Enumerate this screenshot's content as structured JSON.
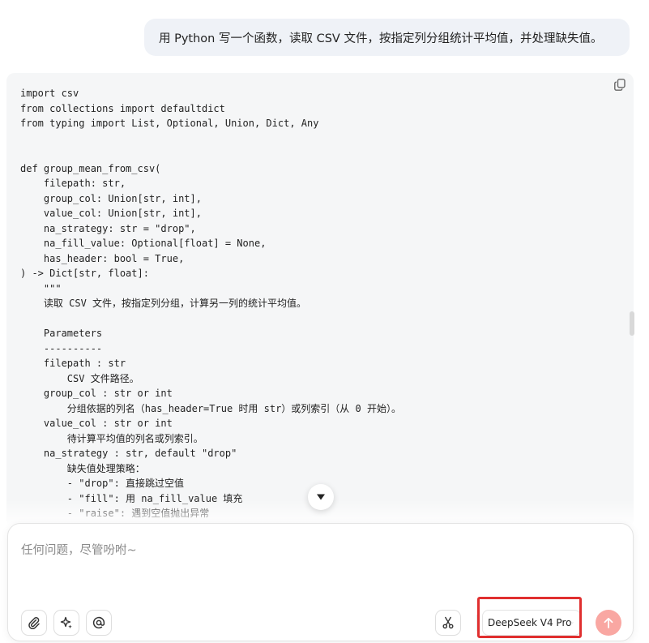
{
  "user_message": {
    "text": "用 Python 写一个函数，读取 CSV 文件，按指定列分组统计平均值，并处理缺失值。"
  },
  "code_block": {
    "language": "python",
    "lines": [
      "import csv",
      "from collections import defaultdict",
      "from typing import List, Optional, Union, Dict, Any",
      "",
      "",
      "def group_mean_from_csv(",
      "    filepath: str,",
      "    group_col: Union[str, int],",
      "    value_col: Union[str, int],",
      "    na_strategy: str = \"drop\",",
      "    na_fill_value: Optional[float] = None,",
      "    has_header: bool = True,",
      ") -> Dict[str, float]:",
      "    \"\"\"",
      "    读取 CSV 文件，按指定列分组，计算另一列的统计平均值。",
      "",
      "    Parameters",
      "    ----------",
      "    filepath : str",
      "        CSV 文件路径。",
      "    group_col : str or int",
      "        分组依据的列名（has_header=True 时用 str）或列索引（从 0 开始）。",
      "    value_col : str or int",
      "        待计算平均值的列名或列索引。",
      "    na_strategy : str, default \"drop\"",
      "        缺失值处理策略：",
      "        - \"drop\": 直接跳过空值",
      "        - \"fill\": 用 na_fill_value 填充",
      "        - \"raise\": 遇到空值抛出异常"
    ]
  },
  "composer": {
    "placeholder": "任何问题，尽管吩咐~",
    "model_name": "DeepSeek V4 Pro"
  },
  "icons": {
    "copy": "copy-icon",
    "scroll_down": "arrow-down-icon",
    "attach": "paperclip-icon",
    "spark": "sparkle-icon",
    "mention": "at-icon",
    "screenshot": "scissors-icon",
    "model_chevron": "chevron-down-icon",
    "send": "arrow-up-icon"
  },
  "colors": {
    "user_bubble_bg": "#eff2f7",
    "code_bg": "#f5f6f7",
    "send_button": "#f9a7a2",
    "highlight_border": "#e02f2f"
  }
}
